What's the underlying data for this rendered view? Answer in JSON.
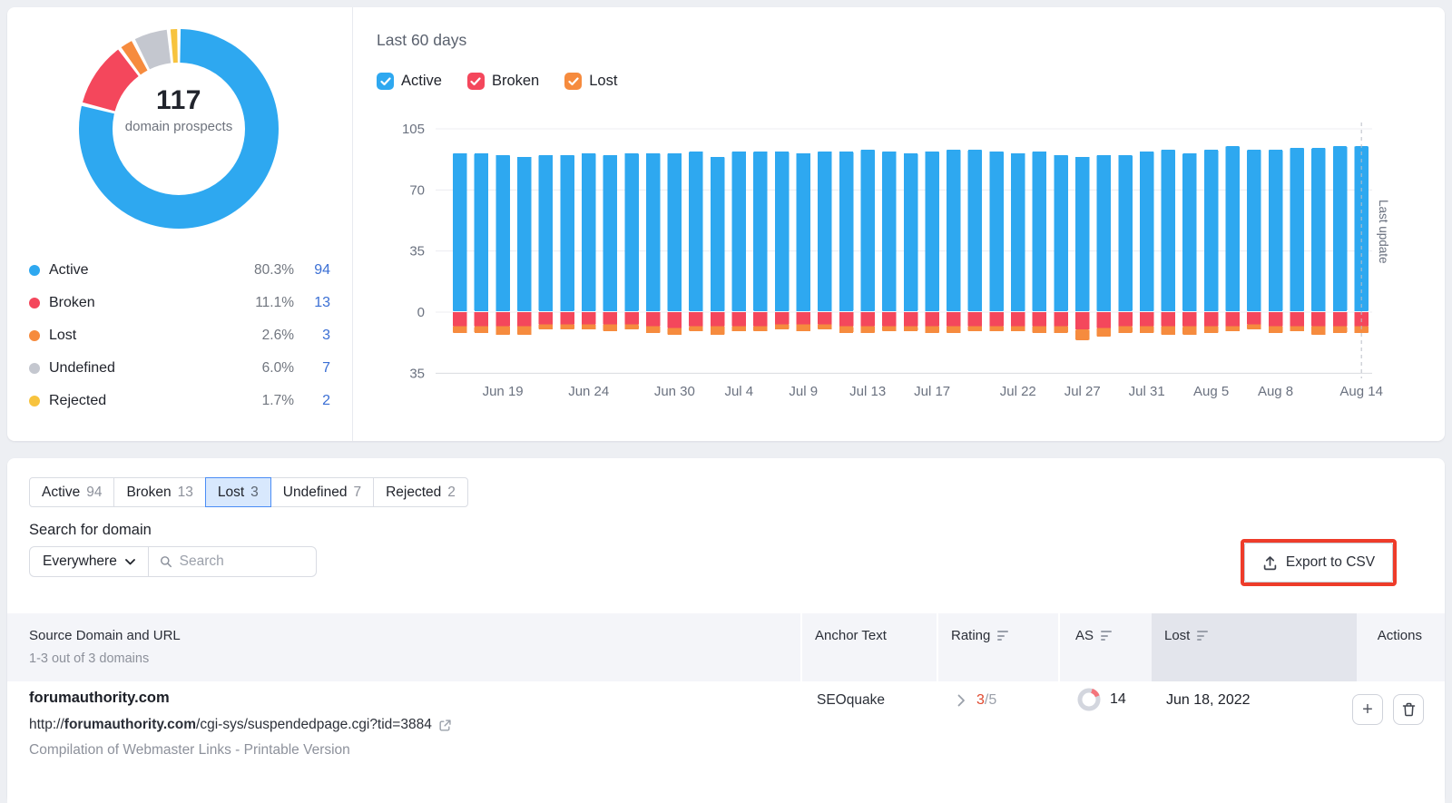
{
  "colors": {
    "active_blue": "#2ea8f0",
    "broken_red": "#f4475c",
    "lost_orange": "#f68b3e",
    "undefined_gray": "#c4c7cf",
    "rejected_yellow": "#f7c33e",
    "link_blue": "#3b6fd4",
    "annotation_red": "#ee3c2a",
    "selected_tab_bg": "#d8e8fd",
    "selected_tab_border": "#4b8df5"
  },
  "donut": {
    "center_value": "117",
    "center_label": "domain prospects",
    "legend": [
      {
        "label": "Active",
        "pct": "80.3%",
        "count": "94",
        "color": "#2ea8f0"
      },
      {
        "label": "Broken",
        "pct": "11.1%",
        "count": "13",
        "color": "#f4475c"
      },
      {
        "label": "Lost",
        "pct": "2.6%",
        "count": "3",
        "color": "#f68b3e"
      },
      {
        "label": "Undefined",
        "pct": "6.0%",
        "count": "7",
        "color": "#c4c7cf"
      },
      {
        "label": "Rejected",
        "pct": "1.7%",
        "count": "2",
        "color": "#f7c33e"
      }
    ]
  },
  "chart": {
    "title": "Last 60 days",
    "filters": [
      {
        "label": "Active",
        "color": "#2ea8f0",
        "checked": true
      },
      {
        "label": "Broken",
        "color": "#f4475c",
        "checked": true
      },
      {
        "label": "Lost",
        "color": "#f68b3e",
        "checked": true
      }
    ],
    "last_update_label": "Last update"
  },
  "chart_data": [
    {
      "type": "pie",
      "title": "117 domain prospects",
      "labels": [
        "Active",
        "Broken",
        "Lost",
        "Undefined",
        "Rejected"
      ],
      "values": [
        94,
        13,
        3,
        7,
        2
      ],
      "percentages": [
        80.3,
        11.1,
        2.6,
        6.0,
        1.7
      ],
      "center_text": "117 domain prospects",
      "donut": true
    },
    {
      "type": "bar",
      "stacked": true,
      "title": "Last 60 days",
      "ylim": [
        -35,
        105
      ],
      "y_ticks": [
        105,
        70,
        35,
        0,
        -35
      ],
      "grid": true,
      "x_tick_labels": [
        "Jun 19",
        "Jun 24",
        "Jun 30",
        "Jul 4",
        "Jul 9",
        "Jul 13",
        "Jul 17",
        "Jul 22",
        "Jul 27",
        "Jul 31",
        "Aug 5",
        "Aug 8",
        "Aug 14"
      ],
      "x_tick_bar_index": [
        2,
        6,
        10,
        13,
        16,
        19,
        22,
        26,
        29,
        32,
        35,
        38,
        42
      ],
      "annotation": {
        "label": "Last update",
        "at_bar_index": 42,
        "style": "dashed-vertical-line"
      },
      "series": [
        {
          "name": "Active",
          "color": "#2ea8f0",
          "values": [
            91,
            91,
            90,
            89,
            90,
            90,
            91,
            90,
            91,
            91,
            91,
            92,
            89,
            92,
            92,
            92,
            91,
            92,
            92,
            93,
            92,
            91,
            92,
            93,
            93,
            92,
            91,
            92,
            90,
            89,
            90,
            90,
            92,
            93,
            91,
            93,
            95,
            93,
            93,
            94,
            94,
            95,
            95
          ]
        },
        {
          "name": "Broken",
          "color": "#f4475c",
          "values": [
            -8,
            -8,
            -8,
            -8,
            -7,
            -7,
            -7,
            -7,
            -7,
            -8,
            -9,
            -8,
            -8,
            -8,
            -8,
            -7,
            -7,
            -7,
            -8,
            -8,
            -8,
            -8,
            -8,
            -8,
            -8,
            -8,
            -8,
            -8,
            -8,
            -10,
            -9,
            -8,
            -8,
            -8,
            -8,
            -8,
            -8,
            -7,
            -8,
            -8,
            -8,
            -8,
            -8
          ]
        },
        {
          "name": "Lost",
          "color": "#f68b3e",
          "values": [
            -4,
            -4,
            -5,
            -5,
            -3,
            -3,
            -3,
            -4,
            -3,
            -4,
            -4,
            -3,
            -5,
            -3,
            -3,
            -3,
            -4,
            -3,
            -4,
            -4,
            -3,
            -3,
            -4,
            -4,
            -3,
            -3,
            -3,
            -4,
            -4,
            -6,
            -5,
            -4,
            -4,
            -5,
            -5,
            -4,
            -3,
            -3,
            -4,
            -3,
            -5,
            -4,
            -4
          ]
        }
      ]
    }
  ],
  "tabs": {
    "selected_index": 2,
    "items": [
      {
        "label": "Active",
        "count": "94"
      },
      {
        "label": "Broken",
        "count": "13"
      },
      {
        "label": "Lost",
        "count": "3"
      },
      {
        "label": "Undefined",
        "count": "7"
      },
      {
        "label": "Rejected",
        "count": "2"
      }
    ]
  },
  "search": {
    "label": "Search for domain",
    "scope": "Everywhere",
    "placeholder": "Search"
  },
  "export": {
    "label": "Export to CSV"
  },
  "table": {
    "headers": {
      "source": "Source Domain and URL",
      "source_sub": "1-3 out of 3 domains",
      "anchor": "Anchor Text",
      "rating": "Rating",
      "as": "AS",
      "lost": "Lost",
      "actions": "Actions"
    },
    "row": {
      "domain": "forumauthority.com",
      "url_prefix": "http://",
      "url_domain": "forumauthority.com",
      "url_path": "/cgi-sys/suspendedpage.cgi?tid=3884",
      "description": "Compilation of Webmaster Links - Printable Version",
      "anchor": "SEOquake",
      "rating_value": "3",
      "rating_total": "/5",
      "as_value": "14",
      "lost_date": "Jun 18, 2022",
      "add_label": "+"
    }
  }
}
